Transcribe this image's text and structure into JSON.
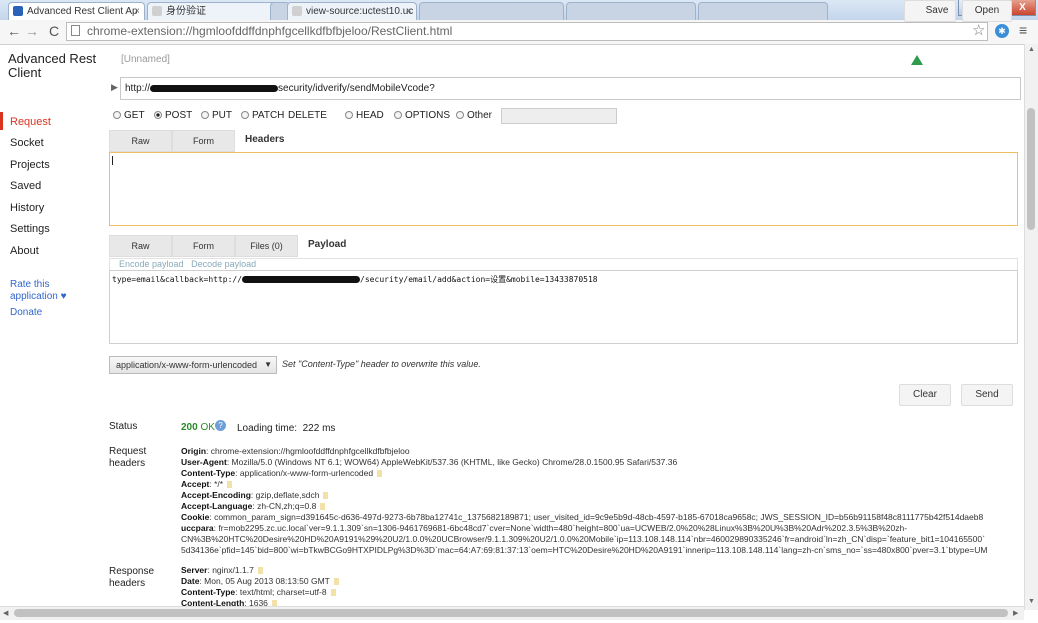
{
  "browser": {
    "tabs": [
      {
        "title": "Advanced Rest Client Ap",
        "active": true
      },
      {
        "title": "身份验证",
        "active": false
      },
      {
        "title": "",
        "active": false
      },
      {
        "title": "view-source:uctest10.uc",
        "active": false
      }
    ],
    "address": "chrome-extension://hgmloofddffdnphfgcellkdfbfbjeloo/RestClient.html",
    "window_controls": {
      "minimize": "_",
      "maximize": "□",
      "close": "X"
    }
  },
  "app": {
    "title": "Advanced Rest Client",
    "nav": [
      "Request",
      "Socket",
      "Projects",
      "Saved",
      "History",
      "Settings",
      "About"
    ],
    "active_nav": "Request",
    "rate_label": "Rate this application ♥",
    "donate_label": "Donate",
    "request_name": "[Unnamed]",
    "save_label": "Save",
    "open_label": "Open"
  },
  "request": {
    "url_prefix": "http://",
    "url_suffix": "security/idverify/sendMobileVcode?",
    "methods": [
      "GET",
      "POST",
      "PUT",
      "PATCH",
      "DELETE",
      "HEAD",
      "OPTIONS",
      "Other"
    ],
    "selected_method": "POST",
    "header_tabs": {
      "raw": "Raw",
      "form": "Form",
      "headers": "Headers"
    },
    "payload_tabs": {
      "raw": "Raw",
      "form": "Form",
      "files": "Files (0)",
      "payload": "Payload"
    },
    "encode_payload": "Encode payload",
    "decode_payload": "Decode payload",
    "payload_prefix": "type=email&callback=http://",
    "payload_suffix": "/security/email/add&action=设置&mobile=13433870518",
    "content_type": "application/x-www-form-urlencoded",
    "content_type_hint": "Set \"Content-Type\" header to overwrite this value.",
    "clear_label": "Clear",
    "send_label": "Send"
  },
  "response": {
    "status_label": "Status",
    "status_code": "200",
    "status_text": "OK",
    "loading_label": "Loading time:",
    "loading_value": "222 ms",
    "request_headers_label": "Request headers",
    "request_headers": [
      {
        "k": "Origin",
        "v": "chrome-extension://hgmloofddffdnphfgcellkdfbfbjeloo"
      },
      {
        "k": "User-Agent",
        "v": "Mozilla/5.0 (Windows NT 6.1; WOW64) AppleWebKit/537.36 (KHTML, like Gecko) Chrome/28.0.1500.95 Safari/537.36"
      },
      {
        "k": "Content-Type",
        "v": "application/x-www-form-urlencoded"
      },
      {
        "k": "Accept",
        "v": "*/*"
      },
      {
        "k": "Accept-Encoding",
        "v": "gzip,deflate,sdch"
      },
      {
        "k": "Accept-Language",
        "v": "zh-CN,zh;q=0.8"
      },
      {
        "k": "Cookie",
        "v": "common_param_sign=d391645c-d636-497d-9273-6b78ba12741c_1375682189871; user_visited_id=9c9e5b9d-48cb-4597-b185-67018ca9658c; JWS_SESSION_ID=b56b91158f48c8111775b42f514daeb8"
      },
      {
        "k": "uccpara",
        "v": "fr=mob2295.zc.uc.local`ver=9.1.1.309`sn=1306-9461769681-6bc48cd7`cver=None`width=480`height=800`ua=UCWEB/2.0%20%28Linux%3B%20U%3B%20Adr%202.3.5%3B%20zh-"
      },
      {
        "k": "",
        "v": "CN%3B%20HTC%20Desire%20HD%20A9191%29%20U2/1.0.0%20UCBrowser/9.1.1.309%20U2/1.0.0%20Mobile`ip=113.108.148.114`nbr=460029890335246`fr=android`ln=zh_CN`disp=`feature_bit1=104165500`"
      },
      {
        "k": "",
        "v": "5d34136e`pfid=145`bid=800`wi=bTkwBCGo9HTXPIDLPg%3D%3D`mac=64:A7:69:81:37:13`oem=HTC%20Desire%20HD%20A9191`innerip=113.108.148.114`lang=zh-cn`sms_no=`ss=480x800`pver=3.1`btype=UM"
      }
    ],
    "response_headers_label": "Response headers",
    "response_headers": [
      {
        "k": "Server",
        "v": "nginx/1.1.7"
      },
      {
        "k": "Date",
        "v": "Mon, 05 Aug 2013 08:13:50 GMT"
      },
      {
        "k": "Content-Type",
        "v": "text/html; charset=utf-8"
      },
      {
        "k": "Content-Length",
        "v": "1636"
      }
    ]
  },
  "colors": {
    "accent": "#d9341f",
    "link": "#3366cc",
    "ok": "#2a8a2a",
    "focus": "#f0c060"
  },
  "icons": [
    "back-arrow-icon",
    "forward-arrow-icon",
    "reload-icon",
    "page-icon",
    "star-icon",
    "extension-icon",
    "menu-icon",
    "drive-icon",
    "info-icon"
  ]
}
